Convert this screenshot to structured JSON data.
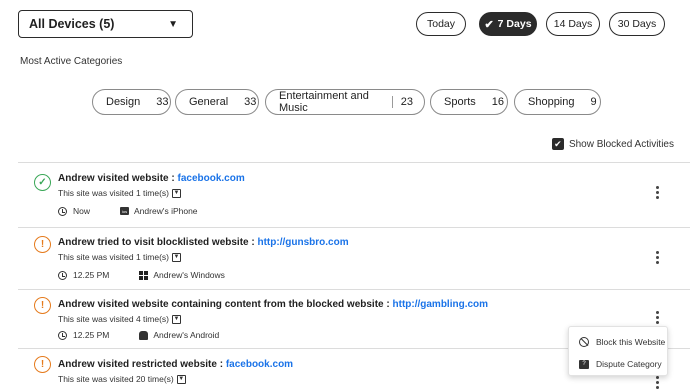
{
  "device_filter": {
    "label": "All Devices (5)"
  },
  "time_ranges": [
    {
      "label": "Today",
      "active": false
    },
    {
      "label": "7 Days",
      "active": true
    },
    {
      "label": "14 Days",
      "active": false
    },
    {
      "label": "30 Days",
      "active": false
    }
  ],
  "categories_section": {
    "title": "Most Active Categories",
    "chips": [
      {
        "name": "Design",
        "count": "33"
      },
      {
        "name": "General",
        "count": "33"
      },
      {
        "name": "Entertainment and Music",
        "count": "23"
      },
      {
        "name": "Sports",
        "count": "16"
      },
      {
        "name": "Shopping",
        "count": "9"
      }
    ]
  },
  "show_blocked": {
    "label": "Show Blocked Activities",
    "checked": true
  },
  "activities": [
    {
      "status": "allowed",
      "title": "Andrew visited  website : ",
      "site": "facebook.com",
      "visits": "This site was visited 1 time(s)",
      "time": "Now",
      "device": "Andrew's iPhone",
      "device_icon": "iphone-icon"
    },
    {
      "status": "warning",
      "title": "Andrew tried to visit blocklisted website : ",
      "site": "http://gunsbro.com",
      "visits": "This site was visited 1 time(s)",
      "time": "12.25 PM",
      "device": "Andrew's Windows",
      "device_icon": "windows-icon"
    },
    {
      "status": "warning",
      "title": "Andrew visited website containing content from the blocked website : ",
      "site": "http://gambling.com",
      "visits": "This site was visited 4 time(s)",
      "time": "12.25 PM",
      "device": "Andrew's Android",
      "device_icon": "android-icon"
    },
    {
      "status": "warning",
      "title": "Andrew visited restricted website : ",
      "site": "facebook.com",
      "visits": "This site was visited 20 time(s)",
      "time": "",
      "device": "",
      "device_icon": ""
    }
  ],
  "context_menu": {
    "items": [
      {
        "label": "Block this Website",
        "icon": "block-icon"
      },
      {
        "label": "Dispute Category",
        "icon": "dispute-icon"
      }
    ]
  },
  "colors": {
    "allowed": "#3aa757",
    "warning": "#e57a1c",
    "link": "#1a73e8",
    "active_button": "#2b2b2b"
  }
}
